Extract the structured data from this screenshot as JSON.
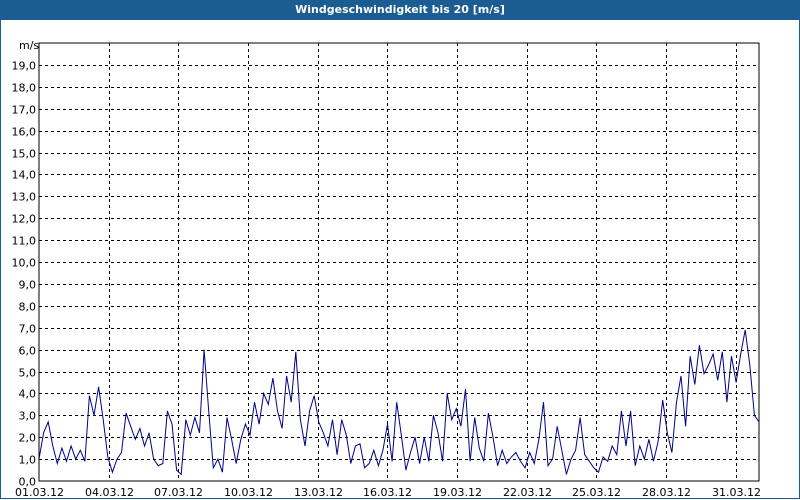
{
  "window": {
    "title": "Windgeschwindigkeit bis 20 [m/s]"
  },
  "colors": {
    "titlebar": "#1b5d93",
    "series": "#00008b",
    "grid": "#000000"
  },
  "chart_data": {
    "type": "line",
    "title": "Windgeschwindigkeit bis 20 [m/s]",
    "ylabel": "m/s",
    "xlabel": "",
    "ylim": [
      0,
      20
    ],
    "xlim": [
      "01.03.12",
      "01.04.12"
    ],
    "grid": true,
    "y_ticks": [
      "0,0",
      "1,0",
      "2,0",
      "3,0",
      "4,0",
      "5,0",
      "6,0",
      "7,0",
      "8,0",
      "9,0",
      "10,0",
      "11,0",
      "12,0",
      "13,0",
      "14,0",
      "15,0",
      "16,0",
      "17,0",
      "18,0",
      "19,0"
    ],
    "x_ticks": [
      "01.03.12",
      "04.03.12",
      "07.03.12",
      "10.03.12",
      "13.03.12",
      "16.03.12",
      "19.03.12",
      "22.03.12",
      "25.03.12",
      "28.03.12",
      "31.03.12"
    ],
    "series": [
      {
        "values": [
          1.0,
          2.2,
          2.7,
          1.6,
          0.8,
          1.5,
          0.9,
          1.6,
          1.0,
          1.4,
          0.9,
          3.9,
          3.0,
          4.3,
          2.8,
          1.1,
          0.4,
          1.0,
          1.3,
          3.1,
          2.5,
          1.9,
          2.4,
          1.6,
          2.2,
          1.0,
          0.7,
          0.8,
          3.2,
          2.6,
          0.5,
          0.3,
          2.8,
          2.1,
          2.9,
          2.2,
          6.0,
          3.2,
          0.6,
          1.0,
          0.4,
          2.9,
          1.9,
          0.8,
          1.9,
          2.6,
          2.1,
          3.6,
          2.6,
          4.0,
          3.5,
          4.7,
          3.2,
          2.4,
          4.8,
          3.6,
          5.9,
          2.8,
          1.6,
          3.2,
          3.9,
          2.7,
          2.2,
          1.6,
          2.8,
          1.2,
          2.8,
          2.1,
          0.8,
          1.6,
          1.7,
          0.6,
          0.8,
          1.4,
          0.7,
          1.4,
          2.6,
          0.9,
          3.6,
          2.1,
          0.5,
          1.3,
          2.0,
          0.8,
          2.0,
          0.9,
          3.0,
          2.2,
          0.9,
          4.0,
          2.8,
          3.3,
          2.5,
          4.2,
          0.9,
          2.9,
          1.5,
          0.9,
          3.1,
          2.0,
          0.7,
          1.4,
          0.8,
          1.1,
          1.3,
          0.9,
          0.6,
          1.3,
          0.8,
          1.9,
          3.6,
          0.7,
          1.0,
          2.5,
          1.4,
          0.3,
          1.0,
          1.4,
          2.9,
          1.2,
          0.9,
          0.6,
          0.4,
          1.1,
          0.9,
          1.6,
          1.2,
          3.2,
          1.6,
          3.2,
          0.7,
          1.6,
          1.0,
          1.9,
          0.9,
          1.8,
          3.7,
          2.2,
          1.3,
          3.6,
          4.8,
          2.5,
          5.7,
          4.4,
          6.2,
          4.9,
          5.3,
          5.8,
          4.6,
          5.9,
          3.6,
          5.7,
          4.5,
          5.8,
          6.9,
          5.3,
          3.0,
          2.7
        ]
      }
    ]
  }
}
